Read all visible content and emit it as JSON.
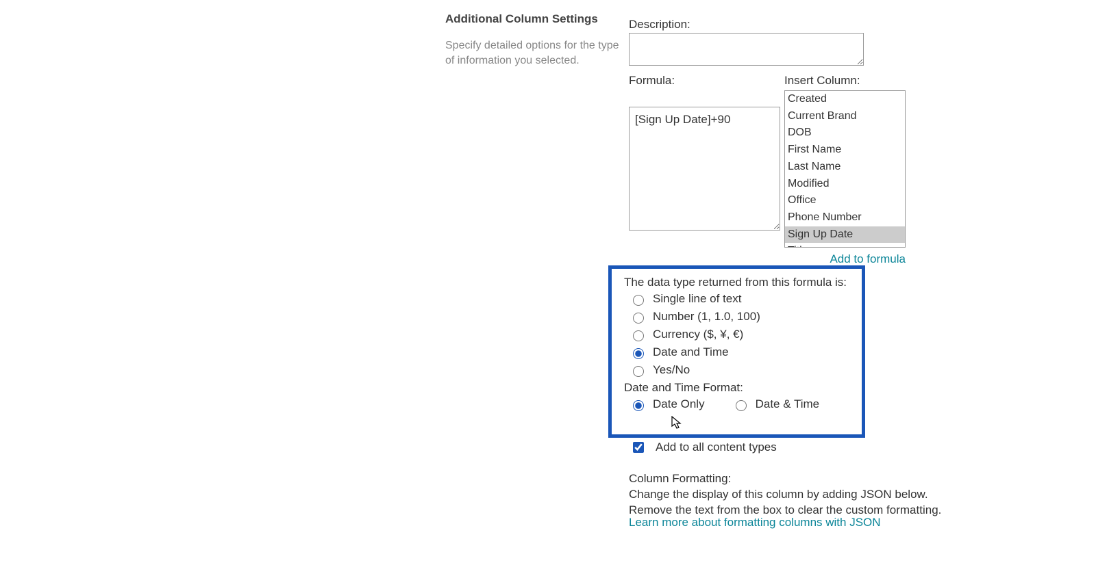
{
  "section": {
    "title": "Additional Column Settings",
    "help": "Specify detailed options for the type of information you selected."
  },
  "description": {
    "label": "Description:",
    "value": ""
  },
  "formula": {
    "label": "Formula:",
    "value": "[Sign Up Date]+90"
  },
  "insertColumn": {
    "label": "Insert Column:",
    "items": [
      {
        "label": "Created",
        "selected": false
      },
      {
        "label": "Current Brand",
        "selected": false
      },
      {
        "label": "DOB",
        "selected": false
      },
      {
        "label": "First Name",
        "selected": false
      },
      {
        "label": "Last Name",
        "selected": false
      },
      {
        "label": "Modified",
        "selected": false
      },
      {
        "label": "Office",
        "selected": false
      },
      {
        "label": "Phone Number",
        "selected": false
      },
      {
        "label": "Sign Up Date",
        "selected": true
      },
      {
        "label": "Title",
        "selected": false
      }
    ],
    "addLink": "Add to formula"
  },
  "dataType": {
    "label": "The data type returned from this formula is:",
    "options": {
      "text": "Single line of text",
      "number": "Number (1, 1.0, 100)",
      "currency": "Currency ($, ¥, €)",
      "datetime": "Date and Time",
      "yesno": "Yes/No"
    },
    "selected": "datetime"
  },
  "dateFormat": {
    "label": "Date and Time Format:",
    "options": {
      "dateOnly": "Date Only",
      "dateTime": "Date & Time"
    },
    "selected": "dateOnly"
  },
  "contentTypes": {
    "label": "Add to all content types",
    "checked": true
  },
  "columnFormatting": {
    "label": "Column Formatting:",
    "desc": "Change the display of this column by adding JSON below. Remove the text from the box to clear the custom formatting.",
    "learnMore": "Learn more about formatting columns with JSON"
  }
}
